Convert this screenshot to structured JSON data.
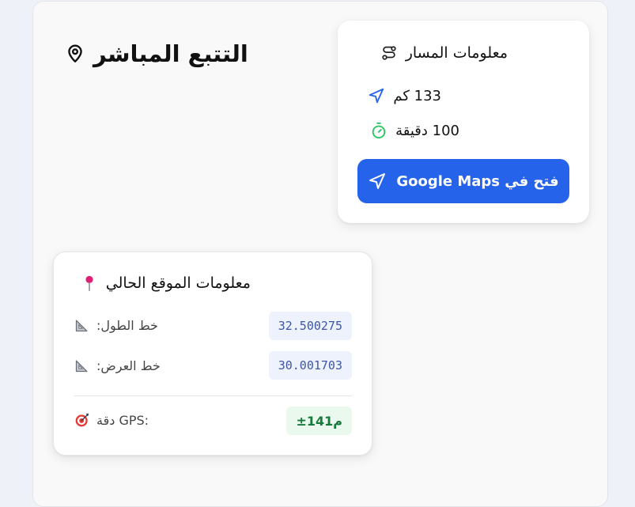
{
  "page": {
    "title": "التتبع المباشر"
  },
  "route_info": {
    "title": "معلومات المسار",
    "distance": "133 كم",
    "duration": "100 دقيقة",
    "open_maps_label": "فتح في Google Maps"
  },
  "location_info": {
    "title": "معلومات الموقع الحالي",
    "longitude_label": ":خط الطول",
    "longitude_value": "32.500275",
    "latitude_label": ":خط العرض",
    "latitude_value": "30.001703",
    "accuracy_label": "دقة GPS:",
    "accuracy_value": "±141م"
  },
  "colors": {
    "primary": "#2563eb",
    "accent_green": "#22c55e",
    "badge_green": "#167a3a",
    "pin_pink": "#e11d74"
  },
  "icons": [
    "map-pin-icon",
    "route-icon",
    "navigation-arrow-icon",
    "timer-icon",
    "pushpin-icon",
    "ruler-icon",
    "target-icon"
  ]
}
